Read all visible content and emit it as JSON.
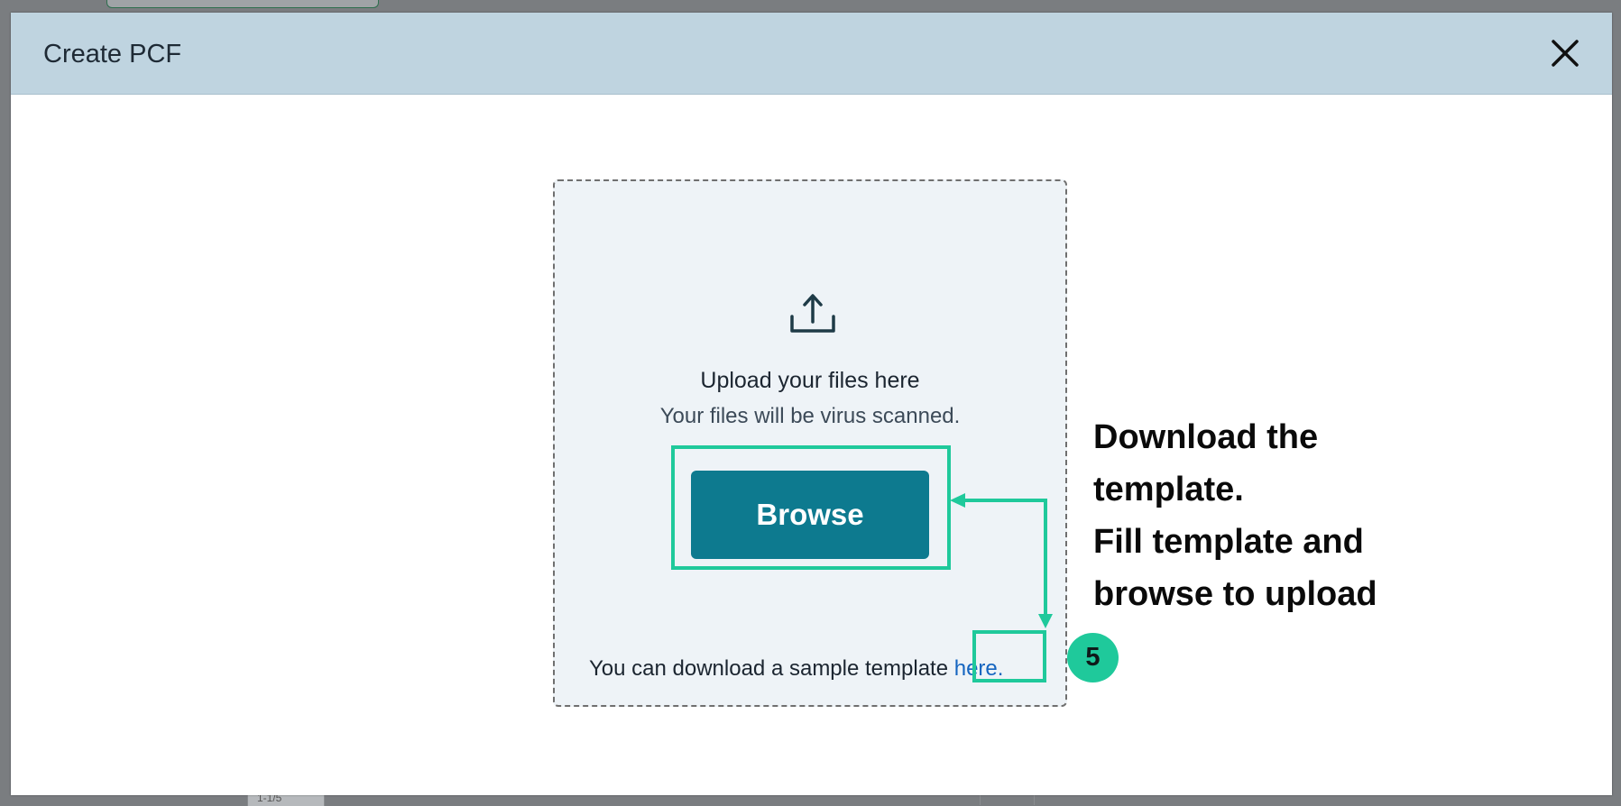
{
  "modal": {
    "title": "Create PCF",
    "close_icon": "close-icon"
  },
  "upload": {
    "icon": "upload-icon",
    "title": "Upload your files here",
    "subtitle": "Your files will be virus scanned.",
    "browse_label": "Browse",
    "sample_prefix": "You can download a sample template ",
    "sample_link": "here."
  },
  "annotation": {
    "step_number": "5",
    "lines": [
      "Download the",
      "template.",
      "Fill template and",
      "browse to upload"
    ],
    "accent_color": "#1fc99b"
  },
  "background": {
    "chip_text": "1-1/5"
  },
  "colors": {
    "header_bg": "#bfd4e0",
    "button_bg": "#0d7a8f",
    "link": "#1565c0"
  }
}
